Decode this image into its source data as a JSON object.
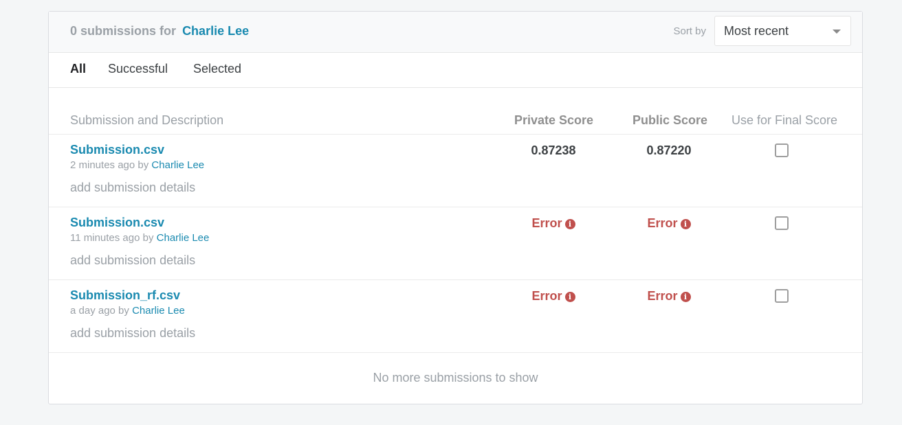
{
  "header": {
    "count_text": "0 submissions for",
    "user_name": "Charlie Lee",
    "sort_label": "Sort by",
    "sort_value": "Most recent"
  },
  "tabs": [
    {
      "label": "All",
      "active": true
    },
    {
      "label": "Successful",
      "active": false
    },
    {
      "label": "Selected",
      "active": false
    }
  ],
  "columns": {
    "description": "Submission and Description",
    "private_score": "Private Score",
    "public_score": "Public Score",
    "final_score": "Use for Final Score"
  },
  "submissions": [
    {
      "filename": "Submission.csv",
      "time_text": "2 minutes ago by",
      "author": "Charlie Lee",
      "details_link": "add submission details",
      "private_score": "0.87238",
      "public_score": "0.87220",
      "selected": false
    },
    {
      "filename": "Submission.csv",
      "time_text": "11 minutes ago by",
      "author": "Charlie Lee",
      "details_link": "add submission details",
      "private_score": "Error",
      "public_score": "Error",
      "selected": false
    },
    {
      "filename": "Submission_rf.csv",
      "time_text": "a day ago by",
      "author": "Charlie Lee",
      "details_link": "add submission details",
      "private_score": "Error",
      "public_score": "Error",
      "selected": false
    }
  ],
  "footer": {
    "message": "No more submissions to show"
  },
  "icons": {
    "error_icon": "info-circle-icon",
    "error_glyph": "i",
    "error_color": "#c0504d",
    "link_color": "#1a8ab0"
  }
}
